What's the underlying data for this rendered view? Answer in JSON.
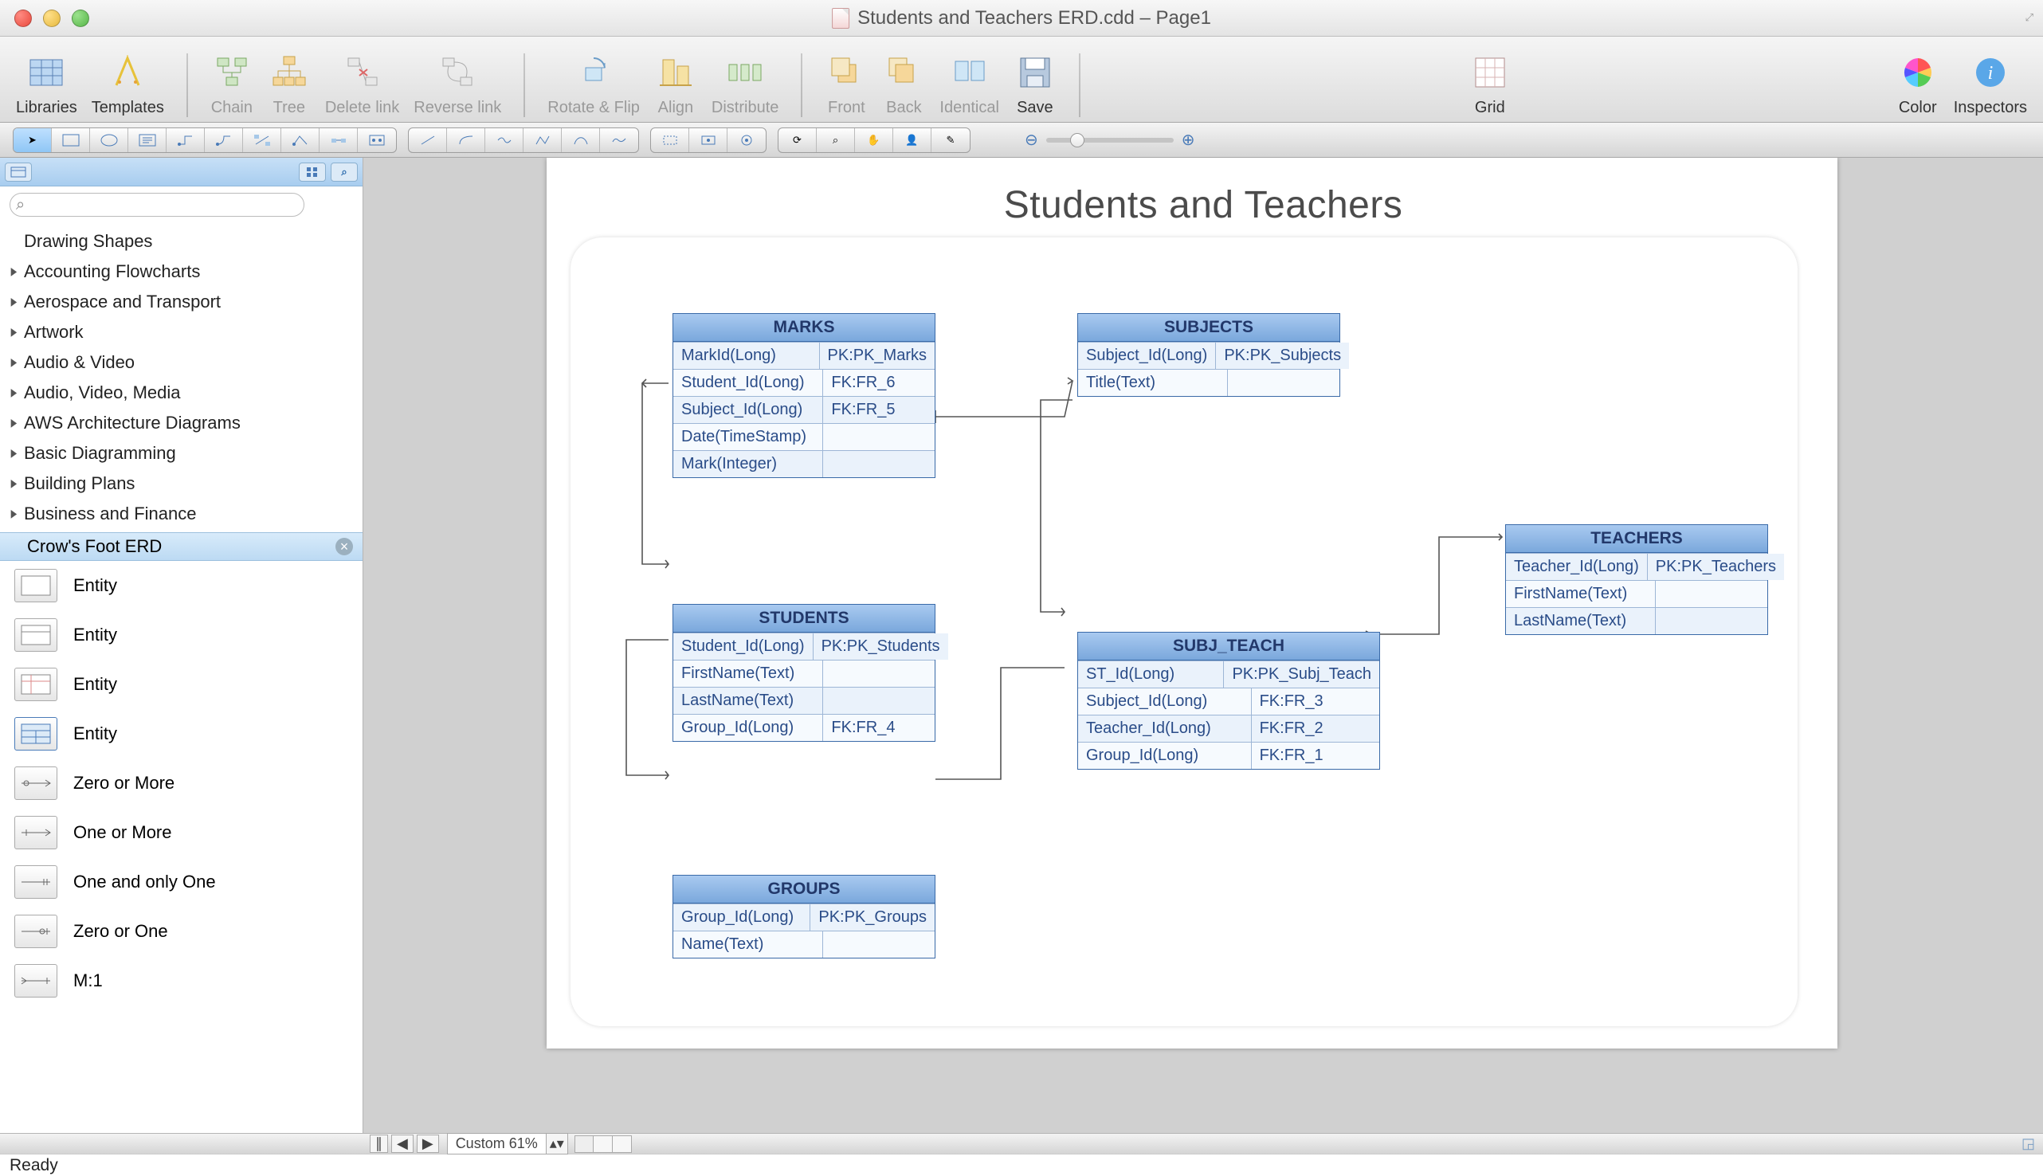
{
  "window": {
    "title": "Students and Teachers ERD.cdd – Page1"
  },
  "toolbar": {
    "libraries": "Libraries",
    "templates": "Templates",
    "chain": "Chain",
    "tree": "Tree",
    "delete_link": "Delete link",
    "reverse_link": "Reverse link",
    "rotate_flip": "Rotate & Flip",
    "align": "Align",
    "distribute": "Distribute",
    "front": "Front",
    "back": "Back",
    "identical": "Identical",
    "save": "Save",
    "grid": "Grid",
    "color": "Color",
    "inspectors": "Inspectors"
  },
  "sidebar": {
    "search_placeholder": "",
    "groups": [
      "Drawing Shapes",
      "Accounting Flowcharts",
      "Aerospace and Transport",
      "Artwork",
      "Audio & Video",
      "Audio, Video, Media",
      "AWS Architecture Diagrams",
      "Basic Diagramming",
      "Building Plans",
      "Business and Finance"
    ],
    "active_group": "Crow's Foot ERD",
    "stencils": [
      "Entity",
      "Entity",
      "Entity",
      "Entity",
      "Zero or More",
      "One or More",
      "One and only One",
      "Zero or One",
      "M:1"
    ]
  },
  "diagram": {
    "title": "Students and Teachers",
    "tables": {
      "marks": {
        "name": "MARKS",
        "rows": [
          [
            "MarkId(Long)",
            "PK:PK_Marks"
          ],
          [
            "Student_Id(Long)",
            "FK:FR_6"
          ],
          [
            "Subject_Id(Long)",
            "FK:FR_5"
          ],
          [
            "Date(TimeStamp)",
            ""
          ],
          [
            "Mark(Integer)",
            ""
          ]
        ]
      },
      "subjects": {
        "name": "SUBJECTS",
        "rows": [
          [
            "Subject_Id(Long)",
            "PK:PK_Subjects"
          ],
          [
            "Title(Text)",
            ""
          ]
        ]
      },
      "students": {
        "name": "STUDENTS",
        "rows": [
          [
            "Student_Id(Long)",
            "PK:PK_Students"
          ],
          [
            "FirstName(Text)",
            ""
          ],
          [
            "LastName(Text)",
            ""
          ],
          [
            "Group_Id(Long)",
            "FK:FR_4"
          ]
        ]
      },
      "subj_teach": {
        "name": "SUBJ_TEACH",
        "rows": [
          [
            "ST_Id(Long)",
            "PK:PK_Subj_Teach"
          ],
          [
            "Subject_Id(Long)",
            "FK:FR_3"
          ],
          [
            "Teacher_Id(Long)",
            "FK:FR_2"
          ],
          [
            "Group_Id(Long)",
            "FK:FR_1"
          ]
        ]
      },
      "teachers": {
        "name": "TEACHERS",
        "rows": [
          [
            "Teacher_Id(Long)",
            "PK:PK_Teachers"
          ],
          [
            "FirstName(Text)",
            ""
          ],
          [
            "LastName(Text)",
            ""
          ]
        ]
      },
      "groups": {
        "name": "GROUPS",
        "rows": [
          [
            "Group_Id(Long)",
            "PK:PK_Groups"
          ],
          [
            "Name(Text)",
            ""
          ]
        ]
      }
    }
  },
  "footer": {
    "zoom_label": "Custom 61%"
  },
  "status": {
    "text": "Ready"
  }
}
